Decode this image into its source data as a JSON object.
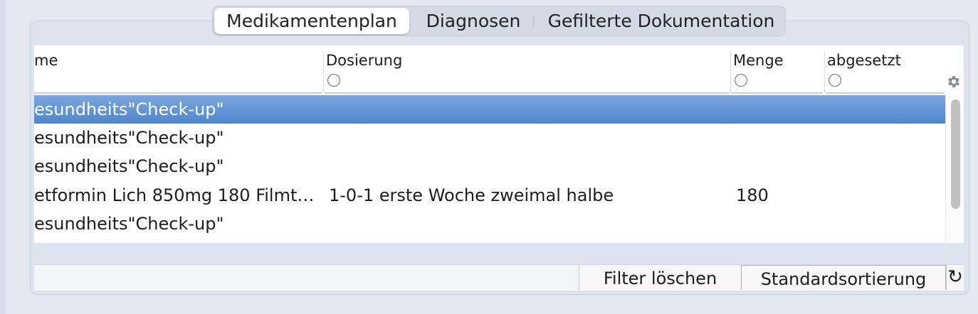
{
  "tabs": [
    {
      "label": "Medikamentenplan",
      "active": true
    },
    {
      "label": "Diagnosen",
      "active": false
    },
    {
      "label": "Gefilterte Dokumentation",
      "active": false
    }
  ],
  "table": {
    "columns": [
      {
        "label": "me",
        "sortable": false
      },
      {
        "label": "Dosierung",
        "sortable": true
      },
      {
        "label": "Menge",
        "sortable": true
      },
      {
        "label": "abgesetzt",
        "sortable": true
      }
    ],
    "rows": [
      {
        "name": "esundheits\"Check-up\"",
        "dosierung": "",
        "menge": "",
        "abgesetzt": "",
        "selected": true
      },
      {
        "name": "esundheits\"Check-up\"",
        "dosierung": "",
        "menge": "",
        "abgesetzt": "",
        "selected": false
      },
      {
        "name": "esundheits\"Check-up\"",
        "dosierung": "",
        "menge": "",
        "abgesetzt": "",
        "selected": false
      },
      {
        "name": "etformin Lich 850mg 180 Filmt…",
        "dosierung": "1-0-1 erste Woche zweimal halbe",
        "menge": "180",
        "abgesetzt": "",
        "selected": false
      },
      {
        "name": "esundheits\"Check-up\"",
        "dosierung": "",
        "menge": "",
        "abgesetzt": "",
        "selected": false
      }
    ]
  },
  "icons": {
    "settings": "gear-icon",
    "refresh": "refresh-icon"
  },
  "buttons": {
    "filter_clear": "Filter löschen",
    "default_sort": "Standardsortierung",
    "refresh_glyph": "↻"
  },
  "colors": {
    "selection": "#5a8fd3",
    "background": "#e3e8f3"
  }
}
